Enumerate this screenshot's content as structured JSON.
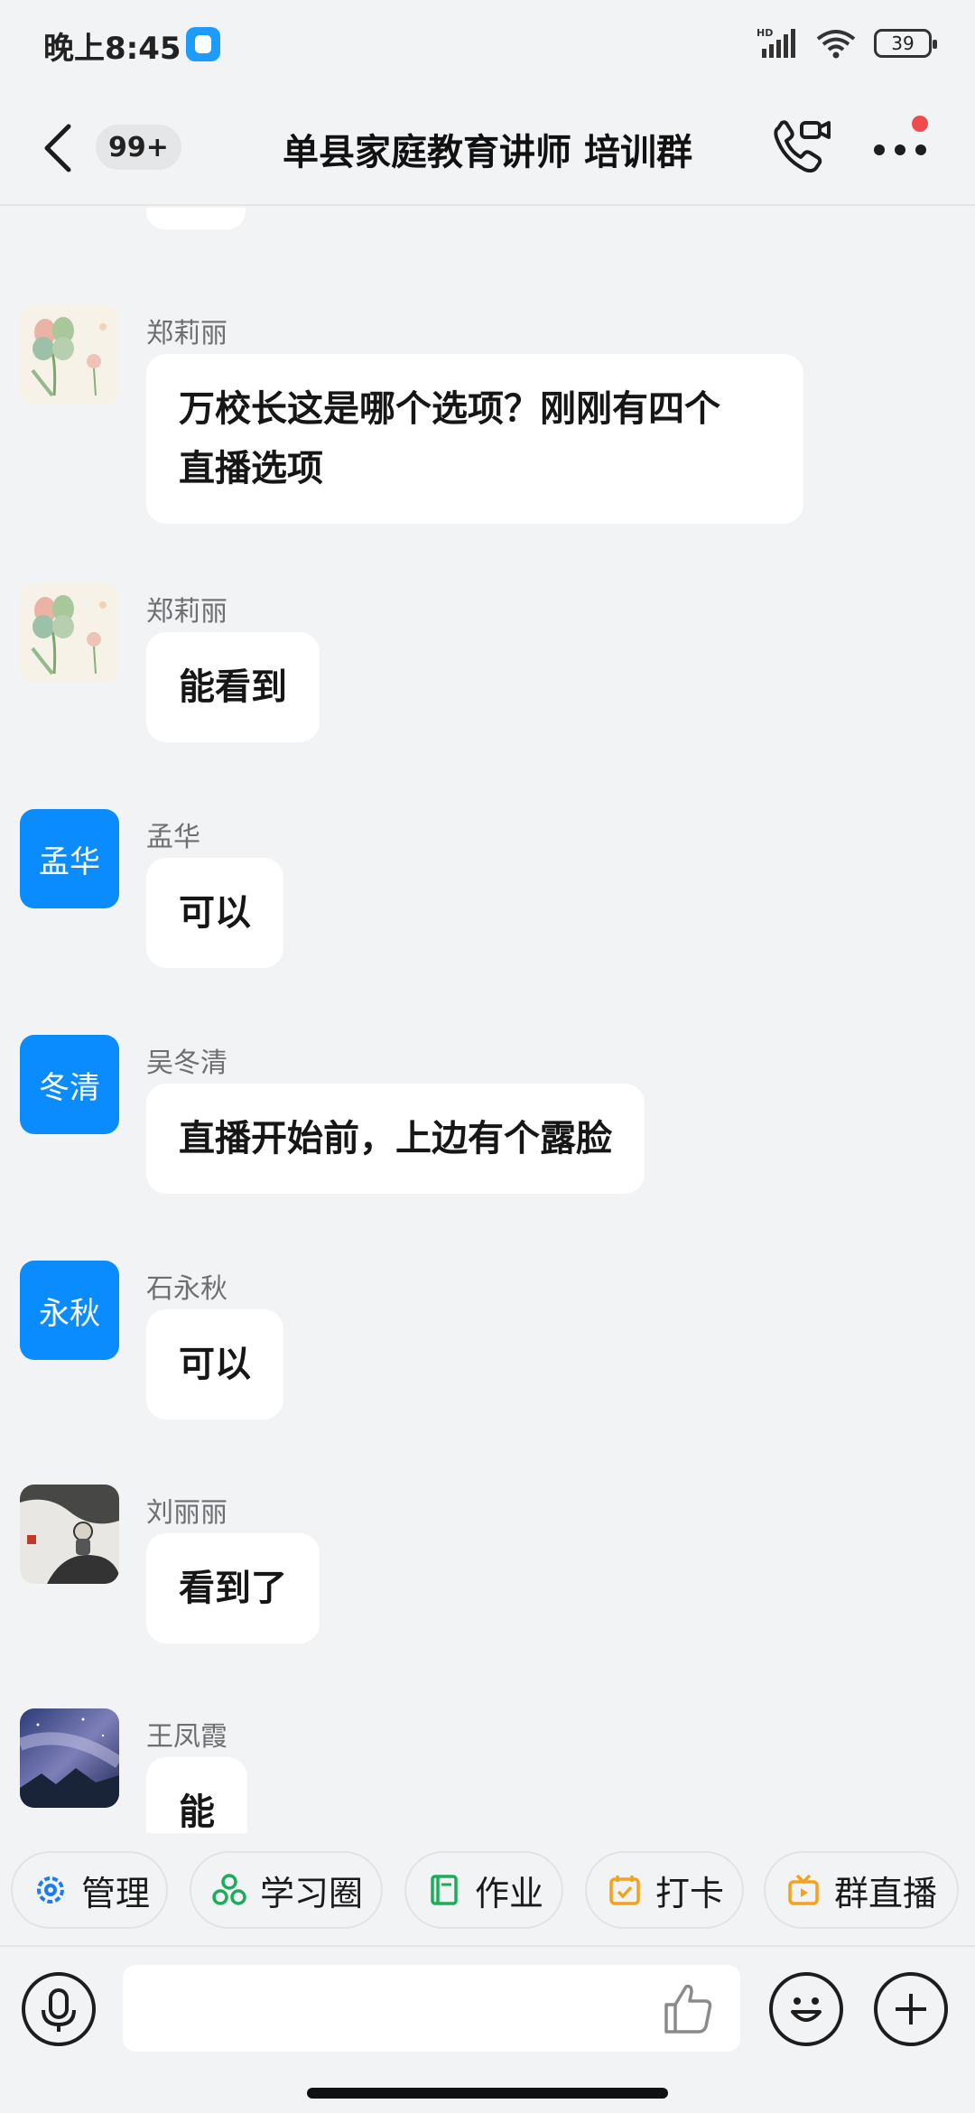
{
  "status_bar": {
    "time": "晚上8:45",
    "network": "HD",
    "battery": "39"
  },
  "header": {
    "unread_count": "99+",
    "title": "单县家庭教育讲师 培训群"
  },
  "messages": [
    {
      "sender": "郑莉丽",
      "avatar": "flower-avatar",
      "text": "万校长这是哪个选项？刚刚有四个\n直播选项"
    },
    {
      "sender": "郑莉丽",
      "avatar": "flower-avatar",
      "text": "能看到"
    },
    {
      "sender": "孟华",
      "avatar_text": "孟华",
      "text": "可以"
    },
    {
      "sender": "吴冬清",
      "avatar_text": "冬清",
      "text": "直播开始前，上边有个露脸"
    },
    {
      "sender": "石永秋",
      "avatar_text": "永秋",
      "text": "可以"
    },
    {
      "sender": "刘丽丽",
      "avatar": "ink-painting-avatar",
      "text": "看到了"
    },
    {
      "sender": "王凤霞",
      "avatar": "starry-mountain-avatar",
      "text": "能"
    }
  ],
  "quick_actions": [
    {
      "label": "管理",
      "icon": "gear-icon",
      "color": "#1a7cf5"
    },
    {
      "label": "学习圈",
      "icon": "circles-icon",
      "color": "#1aae5a"
    },
    {
      "label": "作业",
      "icon": "book-icon",
      "color": "#1aae5a"
    },
    {
      "label": "打卡",
      "icon": "calendar-check-icon",
      "color": "#f4a21c"
    },
    {
      "label": "群直播",
      "icon": "tv-play-icon",
      "color": "#f4a21c"
    }
  ],
  "input": {
    "placeholder": ""
  }
}
